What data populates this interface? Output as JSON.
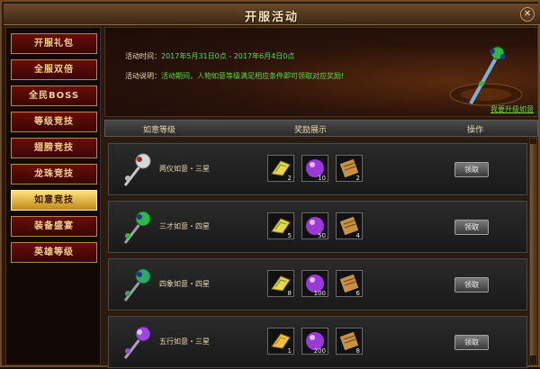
{
  "window": {
    "title": "开服活动",
    "close_glyph": "✕"
  },
  "sidebar": {
    "items": [
      {
        "label": "开服礼包",
        "active": false
      },
      {
        "label": "全服双倍",
        "active": false
      },
      {
        "label": "全民BOSS",
        "active": false
      },
      {
        "label": "等级竞技",
        "active": false
      },
      {
        "label": "翅膀竞技",
        "active": false
      },
      {
        "label": "龙珠竞技",
        "active": false
      },
      {
        "label": "如意竞技",
        "active": true
      },
      {
        "label": "装备盛宴",
        "active": false
      },
      {
        "label": "英雄等级",
        "active": false
      }
    ]
  },
  "banner": {
    "time_label": "活动时间：",
    "time_value": "2017年5月31日0点 - 2017年6月4日0点",
    "desc_label": "活动说明：",
    "desc_value": "活动期间，人物如意等级满足相应条件即可领取对应奖励!",
    "upgrade_link": "我要升级如意"
  },
  "table": {
    "col_level": "如意等级",
    "col_reward": "奖励展示",
    "col_action": "操作"
  },
  "rows": [
    {
      "name": "两仪如意・三星",
      "rewards": [
        "2",
        "10",
        "2"
      ],
      "button": "领取",
      "gem_color": "#d8d8d8"
    },
    {
      "name": "三才如意・四星",
      "rewards": [
        "5",
        "50",
        "4"
      ],
      "button": "领取",
      "gem_color": "#2fb84a"
    },
    {
      "name": "四象如意・四星",
      "rewards": [
        "8",
        "100",
        "6"
      ],
      "button": "领取",
      "gem_color": "#2fa86a"
    },
    {
      "name": "五行如意・三星",
      "rewards": [
        "1",
        "200",
        "8"
      ],
      "button": "领取",
      "gem_color": "#9a4ad8"
    }
  ],
  "icons": {
    "reward_1": "wings-item-icon",
    "reward_2": "purple-orb-icon",
    "reward_3": "scroll-icon"
  },
  "colors": {
    "accent_green": "#5edb3a",
    "active_tab": "#f0c040",
    "tab_red": "#6a0d0a"
  }
}
